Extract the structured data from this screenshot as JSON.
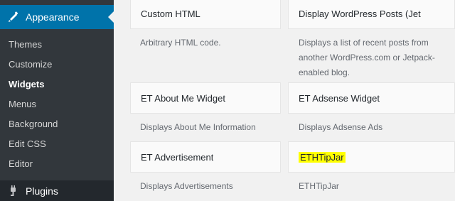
{
  "sidebar": {
    "appearance": {
      "label": "Appearance",
      "icon": "appearance-icon"
    },
    "submenu": [
      {
        "label": "Themes",
        "active": false
      },
      {
        "label": "Customize",
        "active": false
      },
      {
        "label": "Widgets",
        "active": true
      },
      {
        "label": "Menus",
        "active": false
      },
      {
        "label": "Background",
        "active": false
      },
      {
        "label": "Edit CSS",
        "active": false
      },
      {
        "label": "Editor",
        "active": false
      }
    ],
    "plugins": {
      "label": "Plugins",
      "icon": "plugins-icon"
    }
  },
  "widgets": [
    {
      "title": "Custom HTML",
      "description": "Arbitrary HTML code."
    },
    {
      "title": "Display WordPress Posts (Jet",
      "description": "Displays a list of recent posts from another WordPress.com or Jetpack-enabled blog."
    },
    {
      "title": "ET About Me Widget",
      "description": "Displays About Me Information"
    },
    {
      "title": "ET Adsense Widget",
      "description": "Displays Adsense Ads"
    },
    {
      "title": "ET Advertisement",
      "description": "Displays Advertisements"
    },
    {
      "title": "ETHTipJar",
      "description": "ETHTipJar",
      "highlighted": true
    }
  ],
  "colors": {
    "sidebar_bg": "#32373c",
    "active_menu_bg": "#0073aa",
    "highlight": "#ffff00",
    "card_bg": "#fafafa",
    "text": "#23282d",
    "muted_text": "#646970"
  }
}
